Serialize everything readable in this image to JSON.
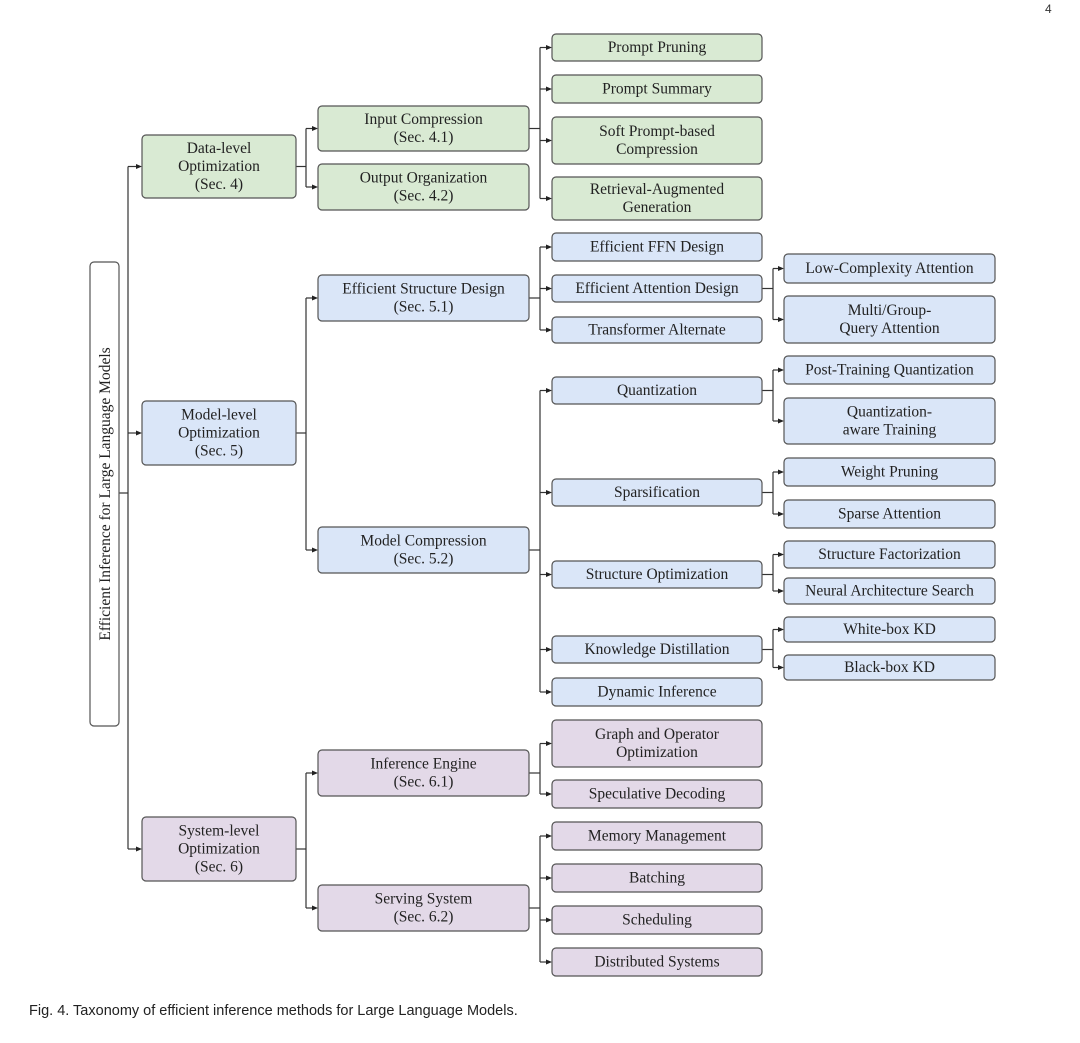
{
  "page_number": "4",
  "caption": "Fig. 4. Taxonomy of efficient inference methods for Large Language Models.",
  "colors": {
    "data_level": "#d9ead3",
    "model_level": "#dae6f8",
    "system_level": "#e3d9e8",
    "root": "#ffffff",
    "border": "#555555"
  },
  "root": {
    "id": "root",
    "label": "Efficient Inference for Large Language Models"
  },
  "nodes": [
    {
      "id": "data",
      "parent": "root",
      "group": "data_level",
      "lines": [
        "Data-level",
        "Optimization",
        "(Sec. 4)"
      ]
    },
    {
      "id": "input_comp",
      "parent": "data",
      "group": "data_level",
      "lines": [
        "Input Compression",
        "(Sec. 4.1)"
      ]
    },
    {
      "id": "output_org",
      "parent": "data",
      "group": "data_level",
      "lines": [
        "Output Organization",
        "(Sec. 4.2)"
      ]
    },
    {
      "id": "prompt_pruning",
      "parent": "input_comp",
      "group": "data_level",
      "lines": [
        "Prompt Pruning"
      ]
    },
    {
      "id": "prompt_summary",
      "parent": "input_comp",
      "group": "data_level",
      "lines": [
        "Prompt Summary"
      ]
    },
    {
      "id": "soft_prompt",
      "parent": "input_comp",
      "group": "data_level",
      "lines": [
        "Soft Prompt-based",
        "Compression"
      ]
    },
    {
      "id": "rag",
      "parent": "input_comp",
      "group": "data_level",
      "lines": [
        "Retrieval-Augmented",
        "Generation"
      ]
    },
    {
      "id": "model",
      "parent": "root",
      "group": "model_level",
      "lines": [
        "Model-level",
        "Optimization",
        "(Sec. 5)"
      ]
    },
    {
      "id": "struct_design",
      "parent": "model",
      "group": "model_level",
      "lines": [
        "Efficient Structure Design",
        "(Sec. 5.1)"
      ]
    },
    {
      "id": "model_comp",
      "parent": "model",
      "group": "model_level",
      "lines": [
        "Model Compression",
        "(Sec. 5.2)"
      ]
    },
    {
      "id": "ffn",
      "parent": "struct_design",
      "group": "model_level",
      "lines": [
        "Efficient FFN Design"
      ]
    },
    {
      "id": "attn",
      "parent": "struct_design",
      "group": "model_level",
      "lines": [
        "Efficient Attention Design"
      ]
    },
    {
      "id": "transformer_alt",
      "parent": "struct_design",
      "group": "model_level",
      "lines": [
        "Transformer Alternate"
      ]
    },
    {
      "id": "low_complexity",
      "parent": "attn",
      "group": "model_level",
      "lines": [
        "Low-Complexity Attention"
      ]
    },
    {
      "id": "mqa",
      "parent": "attn",
      "group": "model_level",
      "lines": [
        "Multi/Group-",
        "Query Attention"
      ]
    },
    {
      "id": "quant",
      "parent": "model_comp",
      "group": "model_level",
      "lines": [
        "Quantization"
      ]
    },
    {
      "id": "sparsification",
      "parent": "model_comp",
      "group": "model_level",
      "lines": [
        "Sparsification"
      ]
    },
    {
      "id": "struct_opt",
      "parent": "model_comp",
      "group": "model_level",
      "lines": [
        "Structure Optimization"
      ]
    },
    {
      "id": "kd",
      "parent": "model_comp",
      "group": "model_level",
      "lines": [
        "Knowledge Distillation"
      ]
    },
    {
      "id": "dynamic",
      "parent": "model_comp",
      "group": "model_level",
      "lines": [
        "Dynamic Inference"
      ]
    },
    {
      "id": "ptq",
      "parent": "quant",
      "group": "model_level",
      "lines": [
        "Post-Training Quantization"
      ]
    },
    {
      "id": "qat",
      "parent": "quant",
      "group": "model_level",
      "lines": [
        "Quantization-",
        "aware Training"
      ]
    },
    {
      "id": "weight_pruning",
      "parent": "sparsification",
      "group": "model_level",
      "lines": [
        "Weight Pruning"
      ]
    },
    {
      "id": "sparse_attn",
      "parent": "sparsification",
      "group": "model_level",
      "lines": [
        "Sparse Attention"
      ]
    },
    {
      "id": "struct_fact",
      "parent": "struct_opt",
      "group": "model_level",
      "lines": [
        "Structure Factorization"
      ]
    },
    {
      "id": "nas",
      "parent": "struct_opt",
      "group": "model_level",
      "lines": [
        "Neural Architecture Search"
      ]
    },
    {
      "id": "whitebox",
      "parent": "kd",
      "group": "model_level",
      "lines": [
        "White-box KD"
      ]
    },
    {
      "id": "blackbox",
      "parent": "kd",
      "group": "model_level",
      "lines": [
        "Black-box KD"
      ]
    },
    {
      "id": "system",
      "parent": "root",
      "group": "system_level",
      "lines": [
        "System-level",
        "Optimization",
        "(Sec. 6)"
      ]
    },
    {
      "id": "inf_engine",
      "parent": "system",
      "group": "system_level",
      "lines": [
        "Inference Engine",
        "(Sec. 6.1)"
      ]
    },
    {
      "id": "serving",
      "parent": "system",
      "group": "system_level",
      "lines": [
        "Serving System",
        "(Sec. 6.2)"
      ]
    },
    {
      "id": "graph_op",
      "parent": "inf_engine",
      "group": "system_level",
      "lines": [
        "Graph and Operator",
        "Optimization"
      ]
    },
    {
      "id": "spec_decoding",
      "parent": "inf_engine",
      "group": "system_level",
      "lines": [
        "Speculative Decoding"
      ]
    },
    {
      "id": "memory",
      "parent": "serving",
      "group": "system_level",
      "lines": [
        "Memory Management"
      ]
    },
    {
      "id": "batching",
      "parent": "serving",
      "group": "system_level",
      "lines": [
        "Batching"
      ]
    },
    {
      "id": "scheduling",
      "parent": "serving",
      "group": "system_level",
      "lines": [
        "Scheduling"
      ]
    },
    {
      "id": "distributed",
      "parent": "serving",
      "group": "system_level",
      "lines": [
        "Distributed Systems"
      ]
    }
  ]
}
